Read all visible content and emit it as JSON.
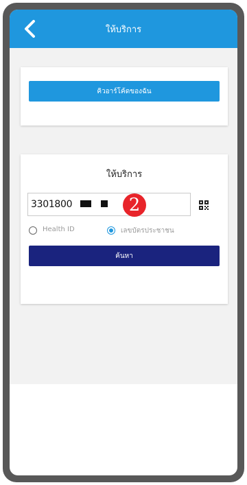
{
  "header": {
    "title": "ให้บริการ",
    "back_icon": "chevron-left-icon"
  },
  "my_qr_button": {
    "label": "คิวอาร์โค้ดของฉัน"
  },
  "service_card": {
    "title": "ให้บริการ",
    "id_input": {
      "value": "3301800",
      "badge": "2"
    },
    "scan_icon": "qr-code-icon",
    "radio_options": [
      {
        "label": "Health ID",
        "checked": false
      },
      {
        "label": "เลขบัตรประชาชน",
        "checked": true
      }
    ],
    "search_button": {
      "label": "ค้นหา"
    }
  },
  "colors": {
    "appbar": "#1f97de",
    "search_button": "#1a237e",
    "badge": "#e8242a"
  }
}
